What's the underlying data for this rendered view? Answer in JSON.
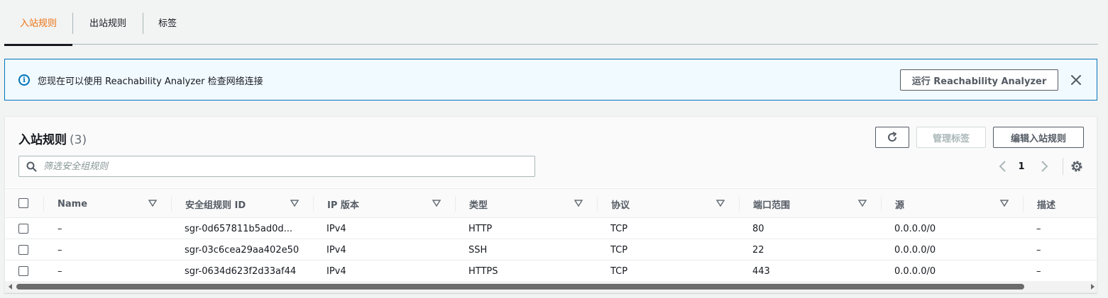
{
  "tabs": [
    {
      "label": "入站规则"
    },
    {
      "label": "出站规则"
    },
    {
      "label": "标签"
    }
  ],
  "banner": {
    "text": "您现在可以使用 Reachability Analyzer 检查网络连接",
    "button_label": "运行 Reachability Analyzer"
  },
  "rules": {
    "title": "入站规则",
    "count": "(3)",
    "manage_tags_label": "管理标签",
    "edit_label": "编辑入站规则",
    "search_placeholder": "筛选安全组规则",
    "page": "1"
  },
  "table": {
    "columns": [
      "Name",
      "安全组规则 ID",
      "IP 版本",
      "类型",
      "协议",
      "端口范围",
      "源",
      "描述"
    ],
    "rows": [
      [
        "–",
        "sgr-0d657811b5ad0d...",
        "IPv4",
        "HTTP",
        "TCP",
        "80",
        "0.0.0.0/0",
        "–"
      ],
      [
        "–",
        "sgr-03c6cea29aa402e50",
        "IPv4",
        "SSH",
        "TCP",
        "22",
        "0.0.0.0/0",
        "–"
      ],
      [
        "–",
        "sgr-0634d623f2d33af44",
        "IPv4",
        "HTTPS",
        "TCP",
        "443",
        "0.0.0.0/0",
        "–"
      ]
    ]
  },
  "colors": {
    "accent": "#ec7211",
    "info": "#0073bb",
    "banner_bg": "#f1faff"
  }
}
